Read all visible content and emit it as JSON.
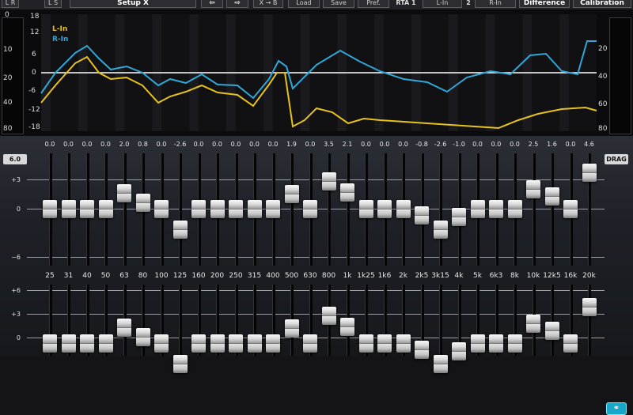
{
  "toolbar": {
    "items": [
      "L R",
      "L S",
      "Setup X",
      "⇦",
      "⇨",
      "X → B",
      "Load",
      "Save",
      "Pref.",
      "RTA 1",
      "L-In",
      "2",
      "R-In",
      "Difference",
      "Calibration"
    ]
  },
  "graph": {
    "left_axis": [
      "18",
      "12",
      "6",
      "0",
      "-6",
      "-12",
      "-18"
    ],
    "right_axis": [
      "20",
      "40",
      "60",
      "80"
    ],
    "meter_axis": [
      "0",
      "10",
      "20",
      "40",
      "80"
    ],
    "legend": [
      {
        "label": "L-In",
        "color": "#e6c21a"
      },
      {
        "label": "R-In",
        "color": "#2fa8d8"
      }
    ]
  },
  "eq": {
    "gain_display": "6.0",
    "drag_label": "DRAG",
    "link_icon": "link-icon",
    "top_scale": [
      "+3",
      "0",
      "−6"
    ],
    "bottom_scale": [
      "+6",
      "+3",
      "0"
    ],
    "frequencies": [
      "25",
      "31",
      "40",
      "50",
      "63",
      "80",
      "100",
      "125",
      "160",
      "200",
      "250",
      "315",
      "400",
      "500",
      "630",
      "800",
      "1k",
      "1k25",
      "1k6",
      "2k",
      "2k5",
      "3k15",
      "4k",
      "5k",
      "6k3",
      "8k",
      "10k",
      "12k5",
      "16k",
      "20k"
    ],
    "gains": [
      "0.0",
      "0.0",
      "0.0",
      "0.0",
      "2.0",
      "0.8",
      "0.0",
      "-2.6",
      "0.0",
      "0.0",
      "0.0",
      "0.0",
      "0.0",
      "1.9",
      "0.0",
      "3.5",
      "2.1",
      "0.0",
      "0.0",
      "0.0",
      "-0.8",
      "-2.6",
      "-1.0",
      "0.0",
      "0.0",
      "0.0",
      "2.5",
      "1.6",
      "0.0",
      "4.6"
    ]
  },
  "colors": {
    "left": "#e6c21a",
    "right": "#2fa8d8",
    "accent": "#17a7c9"
  }
}
